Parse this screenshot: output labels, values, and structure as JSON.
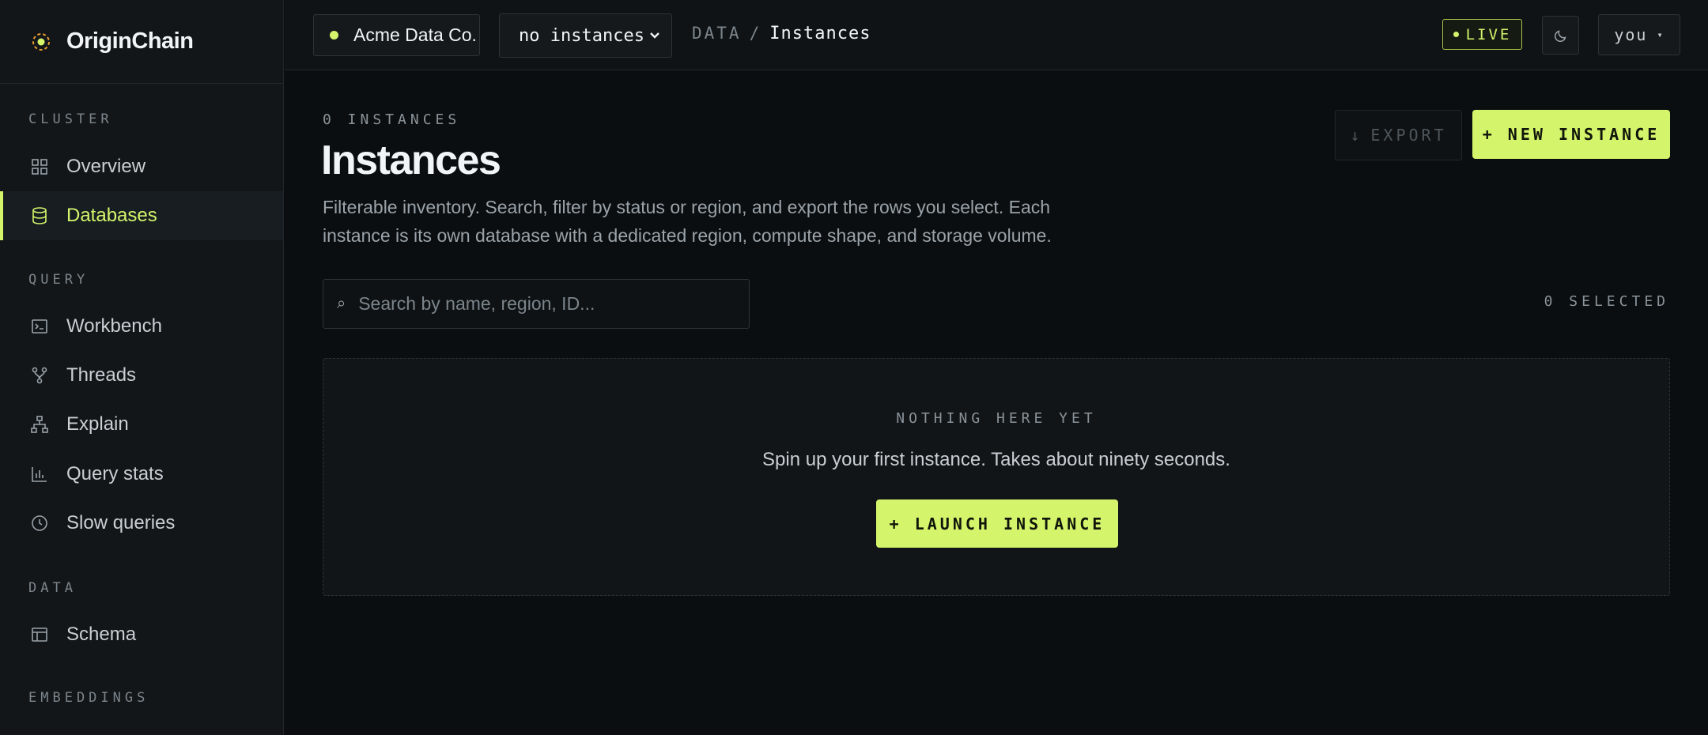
{
  "brand": {
    "name": "OriginChain"
  },
  "sidebar": {
    "sections": [
      {
        "label": "CLUSTER"
      },
      {
        "label": "QUERY"
      },
      {
        "label": "DATA"
      },
      {
        "label": "EMBEDDINGS"
      }
    ],
    "items": [
      {
        "label": "Overview",
        "icon": "grid-icon"
      },
      {
        "label": "Databases",
        "icon": "database-icon",
        "active": true
      },
      {
        "label": "Workbench",
        "icon": "terminal-icon"
      },
      {
        "label": "Threads",
        "icon": "branch-icon"
      },
      {
        "label": "Explain",
        "icon": "hierarchy-icon"
      },
      {
        "label": "Query stats",
        "icon": "bar-chart-icon"
      },
      {
        "label": "Slow queries",
        "icon": "clock-icon"
      },
      {
        "label": "Schema",
        "icon": "table-icon"
      }
    ]
  },
  "topbar": {
    "org_name": "Acme Data Co.",
    "instance_select": "no instances",
    "breadcrumb": {
      "parent": "DATA",
      "separator": "/",
      "current": "Instances"
    },
    "live_label": "LIVE",
    "user_label": "you",
    "user_caret": "▾"
  },
  "main": {
    "count_label": "0 INSTANCES",
    "title": "Instances",
    "description": "Filterable inventory. Search, filter by status or region, and export the rows you select. Each instance is its own database with a dedicated region, compute shape, and storage volume.",
    "export_label": "EXPORT",
    "export_icon": "↓",
    "new_label": "+ NEW INSTANCE",
    "search_icon": "⌕",
    "search_placeholder": "Search by name, region, ID...",
    "selected_label": "0 SELECTED",
    "empty": {
      "label": "NOTHING HERE YET",
      "text": "Spin up your first instance. Takes about ninety seconds.",
      "button": "+ LAUNCH INSTANCE"
    }
  },
  "colors": {
    "accent": "#d4f56b",
    "background": "#0b0e10",
    "sidebar": "#121619"
  }
}
